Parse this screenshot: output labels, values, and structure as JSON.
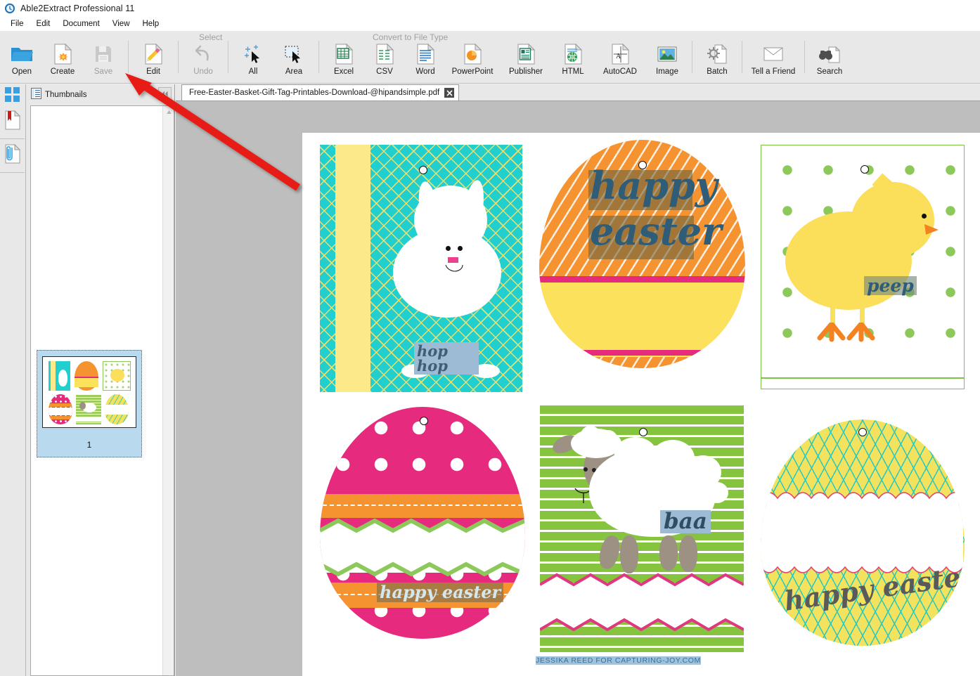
{
  "window": {
    "title": "Able2Extract Professional 11",
    "app_icon": "app-clock-icon"
  },
  "menubar": {
    "items": [
      {
        "label": "File"
      },
      {
        "label": "Edit"
      },
      {
        "label": "Document"
      },
      {
        "label": "View"
      },
      {
        "label": "Help"
      }
    ]
  },
  "toolbar": {
    "group_labels": {
      "select": "Select",
      "convert": "Convert to File Type"
    },
    "buttons": [
      {
        "label": "Open",
        "icon": "open-folder-icon",
        "enabled": true
      },
      {
        "label": "Create",
        "icon": "create-document-icon",
        "enabled": true
      },
      {
        "label": "Save",
        "icon": "save-floppy-icon",
        "enabled": false
      },
      {
        "label": "Edit",
        "icon": "edit-pencil-icon",
        "enabled": true
      },
      {
        "label": "Undo",
        "icon": "undo-arrow-icon",
        "enabled": false
      },
      {
        "label": "All",
        "icon": "select-all-cursor-icon",
        "enabled": true
      },
      {
        "label": "Area",
        "icon": "select-area-cursor-icon",
        "enabled": true
      },
      {
        "label": "Excel",
        "icon": "excel-file-icon",
        "enabled": true
      },
      {
        "label": "CSV",
        "icon": "csv-file-icon",
        "enabled": true
      },
      {
        "label": "Word",
        "icon": "word-file-icon",
        "enabled": true
      },
      {
        "label": "PowerPoint",
        "icon": "powerpoint-file-icon",
        "enabled": true
      },
      {
        "label": "Publisher",
        "icon": "publisher-file-icon",
        "enabled": true
      },
      {
        "label": "HTML",
        "icon": "html-file-icon",
        "enabled": true
      },
      {
        "label": "AutoCAD",
        "icon": "autocad-file-icon",
        "enabled": true
      },
      {
        "label": "Image",
        "icon": "image-file-icon",
        "enabled": true
      },
      {
        "label": "Batch",
        "icon": "batch-gear-icon",
        "enabled": true
      },
      {
        "label": "Tell a Friend",
        "icon": "envelope-icon",
        "enabled": true
      },
      {
        "label": "Search",
        "icon": "binoculars-icon",
        "enabled": true
      }
    ]
  },
  "rail": {
    "items": [
      {
        "name": "panels-grid-icon"
      },
      {
        "name": "bookmarks-document-icon"
      },
      {
        "name": "attachments-clip-icon"
      }
    ]
  },
  "thumbnails_panel": {
    "header": "Thumbnails",
    "header_icon": "thumbnails-list-icon",
    "collapse_icon": "collapse-left-icon",
    "pages": [
      {
        "number": "1",
        "selected": true
      }
    ]
  },
  "document_tab": {
    "filename": "Free-Easter-Basket-Gift-Tag-Printables-Download-@hipandsimple.pdf",
    "close_icon": "close-icon"
  },
  "document": {
    "tags": [
      {
        "id": "bunny",
        "text": "hop hop",
        "text_selected": true,
        "theme": "teal-chevron"
      },
      {
        "id": "orange-egg",
        "text_lines": [
          "happy",
          "easter"
        ],
        "text_selected": true,
        "theme": "orange-dash"
      },
      {
        "id": "chick",
        "text": "peep",
        "text_selected": true,
        "theme": "green-dots"
      },
      {
        "id": "pink-egg",
        "text": "happy easter",
        "text_selected": true,
        "theme": "pink-dots"
      },
      {
        "id": "sheep",
        "text": "baa",
        "text_selected": true,
        "theme": "green-stripes"
      },
      {
        "id": "yellow-egg",
        "text": "happy easter",
        "text_selected": false,
        "theme": "yellow-chevron"
      }
    ],
    "credit": "JESSIKA REED FOR CAPTURING-JOY.COM",
    "credit_selected": true
  },
  "annotation": {
    "arrow": "red-pointer-arrow",
    "points_to": "Edit",
    "color": "#e81e13"
  },
  "colors": {
    "teal": "#22cfcf",
    "yellow": "#fbe98a",
    "orange": "#f59331",
    "pink": "#e62a7e",
    "green": "#86c440",
    "chick_yellow": "#fbdf5a",
    "selection_blue": "#9dbbd4",
    "chrome": "#e8e8e8",
    "viewer_gray": "#bebebe"
  }
}
